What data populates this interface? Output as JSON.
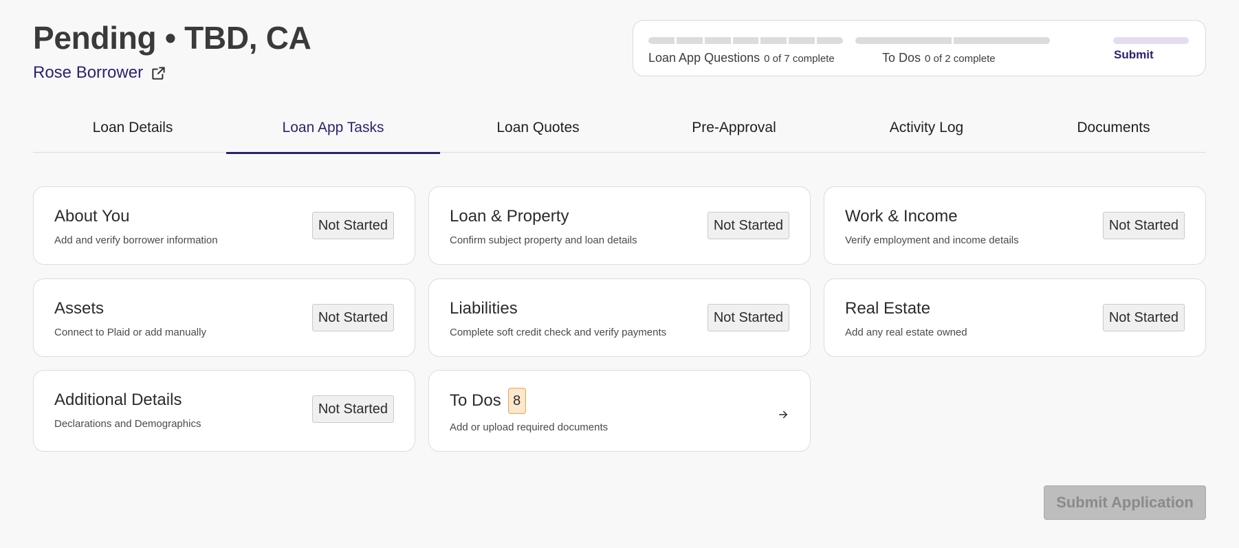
{
  "header": {
    "title": "Pending • TBD, CA",
    "borrower_name": "Rose Borrower",
    "borrower_icon": "external-share-icon"
  },
  "progress": {
    "loan_app": {
      "label": "Loan App Questions",
      "count": "0 of 7 complete",
      "completed": 0,
      "total": 7
    },
    "todos": {
      "label": "To Dos",
      "count": "0 of 2 complete",
      "completed": 0,
      "total": 2
    },
    "submit_label": "Submit"
  },
  "tabs": [
    {
      "label": "Loan Details",
      "active": false
    },
    {
      "label": "Loan App Tasks",
      "active": true
    },
    {
      "label": "Loan Quotes",
      "active": false
    },
    {
      "label": "Pre-Approval",
      "active": false
    },
    {
      "label": "Activity Log",
      "active": false
    },
    {
      "label": "Documents",
      "active": false
    }
  ],
  "tasks": [
    {
      "title": "About You",
      "subtitle": "Add and verify borrower information",
      "status": "Not Started"
    },
    {
      "title": "Loan & Property",
      "subtitle": "Confirm subject property and loan details",
      "status": "Not Started"
    },
    {
      "title": "Work & Income",
      "subtitle": "Verify employment and income details",
      "status": "Not Started"
    },
    {
      "title": "Assets",
      "subtitle": "Connect to Plaid or add manually",
      "status": "Not Started"
    },
    {
      "title": "Liabilities",
      "subtitle": "Complete soft credit check and verify payments",
      "status": "Not Started"
    },
    {
      "title": "Real Estate",
      "subtitle": "Add any real estate owned",
      "status": "Not Started"
    },
    {
      "title": "Additional Details",
      "subtitle": "Declarations and Demographics",
      "status": "Not Started"
    }
  ],
  "todos_card": {
    "title": "To Dos",
    "badge": "8",
    "subtitle": "Add or upload required documents",
    "icon": "arrow-right-icon"
  },
  "actions": {
    "submit_application_label": "Submit Application"
  },
  "colors": {
    "brand": "#2e1f6e",
    "badge_bg": "#fde7cf",
    "badge_border": "#f0a24a",
    "disabled_button": "#bdbdbd"
  }
}
